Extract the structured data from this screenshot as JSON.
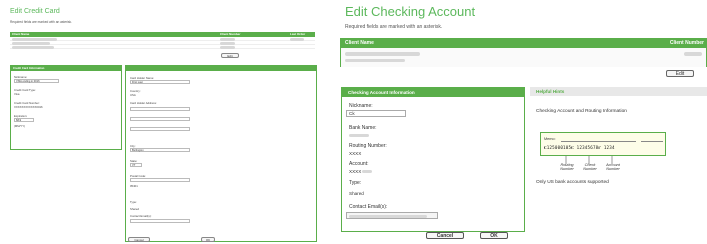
{
  "left": {
    "title": "Edit Credit Card",
    "required_note": "Required fields are marked with an asterisk.",
    "client_table": {
      "col_name": "Client Name",
      "col_number": "Client Number",
      "col_last": "Last Order"
    },
    "edit_label": "Edit",
    "cc_panel": {
      "header": "Credit Card Information",
      "nickname_label": "Nickname:",
      "nickname_value": "VISA ending in 0016",
      "type_label": "Credit Card Type:",
      "type_value": "Visa",
      "number_label": "Credit Card Number:",
      "number_value": "XXXXXXXXXXXX0016",
      "exp_label": "Expiration:",
      "exp_month": "8/19",
      "exp_sub": "(MM/YY)"
    },
    "holder_panel": {
      "name_label": "Card Holder Name:",
      "name_value": "First Last",
      "country_label": "Country:",
      "country_value": "USA",
      "address_label": "Card Holder Address:",
      "city_label": "City:",
      "city_value": "Burlington",
      "state_label": "State:",
      "state_value": "VT",
      "postal_label": "Postal Code:",
      "postal_value": "05401",
      "type_label": "Type:",
      "type_value": "Shared",
      "email_label": "Contact Email(s):"
    },
    "cancel_label": "Cancel",
    "ok_label": "OK"
  },
  "right": {
    "title": "Edit Checking Account",
    "required_note": "Required fields are marked with an asterisk.",
    "client_name_header": "Client Name",
    "client_number_header": "Client Number",
    "edit_label": "Edit",
    "panel_header": "Checking Account Information",
    "nickname_label": "Nickname:",
    "nickname_value": "Ck",
    "bank_label": "Bank Name:",
    "routing_label": "Routing Number:",
    "routing_value": "XXXX",
    "account_label": "Account:",
    "account_value": "XXXX",
    "type_label": "Type:",
    "type_value": "Shared",
    "email_label": "Contact Email(s):",
    "cancel_label": "Cancel",
    "ok_label": "OK",
    "help": {
      "header": "Helpful Hints",
      "subtitle": "Checking Account and Routing Information",
      "memo": "Memo:",
      "micr": "⑆125000105⑆ 12345678⑈ 1234",
      "cap_routing": "Routing\nNumber",
      "cap_check": "Check\nNumber",
      "cap_account": "Account\nNumber",
      "only_us": "Only US bank accounts supported"
    }
  },
  "colors": {
    "accent": "#5aae4a",
    "title_green": "#5cb85c"
  }
}
